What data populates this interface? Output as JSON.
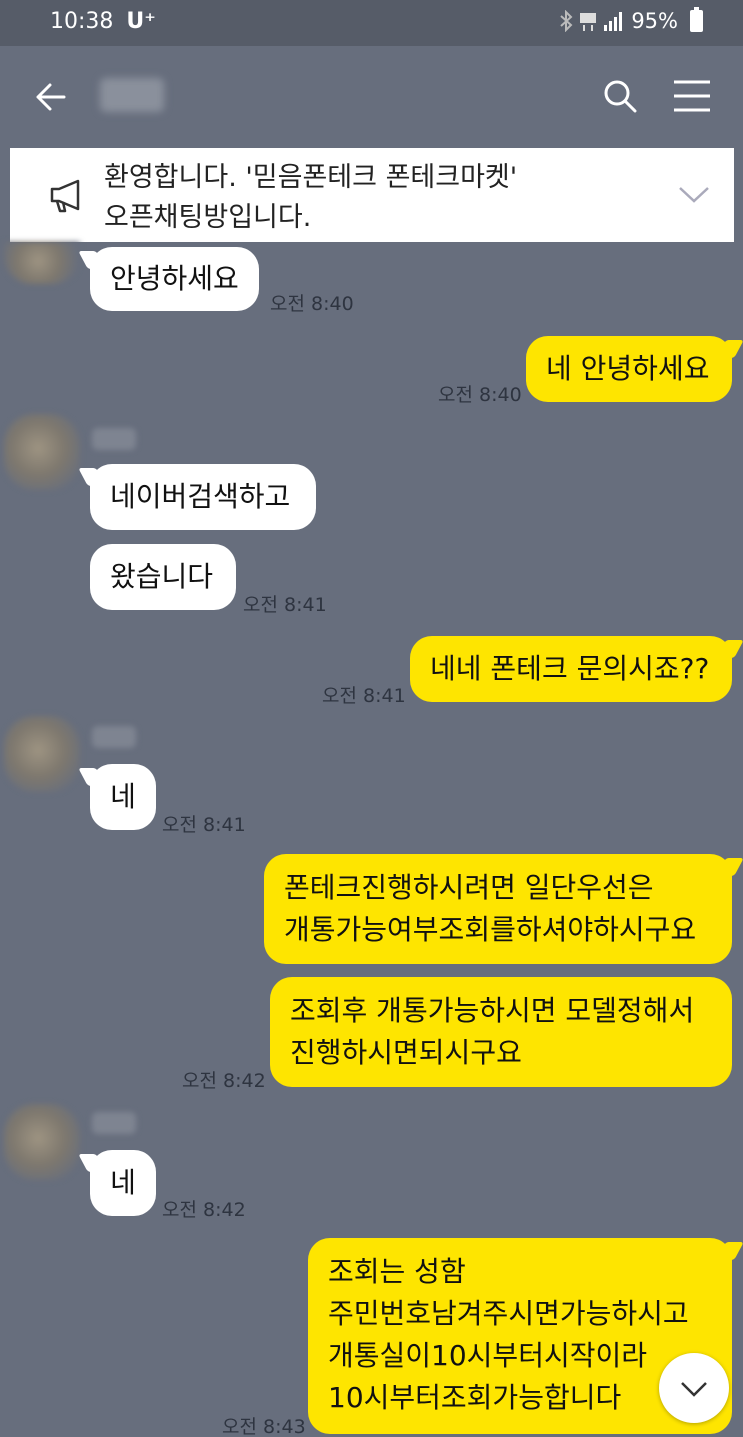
{
  "status_bar": {
    "time": "10:38",
    "carrier": "U⁺",
    "battery": "95%"
  },
  "notice": {
    "line1": "환영합니다. '믿음폰테크 폰테크마켓'",
    "line2": "오픈채팅방입니다."
  },
  "messages": [
    {
      "text": "안녕하세요",
      "time": "오전 8:40"
    },
    {
      "text": "네 안녕하세요",
      "time": "오전 8:40"
    },
    {
      "text": "네이버검색하고"
    },
    {
      "text": "왔습니다",
      "time": "오전 8:41"
    },
    {
      "text": "네네 폰테크 문의시죠??",
      "time": "오전 8:41"
    },
    {
      "text": "네",
      "time": "오전 8:41"
    },
    {
      "lines": [
        "폰테크진행하시려면 일단우선은",
        "개통가능여부조회를하셔야하시구요"
      ]
    },
    {
      "lines": [
        "조회후 개통가능하시면 모델정해서",
        "진행하시면되시구요"
      ],
      "time": "오전 8:42"
    },
    {
      "text": "네",
      "time": "오전 8:42"
    },
    {
      "lines": [
        "조회는 성함",
        "주민번호남겨주시면가능하시고",
        "개통실이10시부터시작이라",
        "10시부터조회가능합니다"
      ],
      "time": "오전 8:43"
    }
  ],
  "colors": {
    "background": "#676E7D",
    "my_bubble": "#FEE500",
    "other_bubble": "#FFFFFF"
  }
}
